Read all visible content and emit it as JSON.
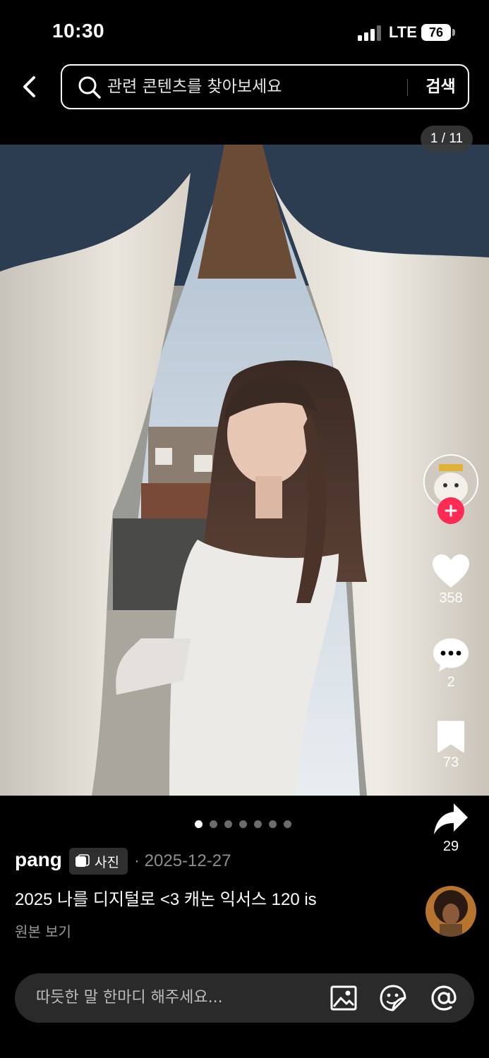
{
  "status_bar": {
    "time": "10:30",
    "network": "LTE",
    "battery": "76"
  },
  "search": {
    "placeholder": "관련 콘텐츠를 찾아보세요",
    "button_label": "검색"
  },
  "photo_counter": "1 / 11",
  "actions": {
    "likes": "358",
    "comments": "2",
    "saves": "73",
    "shares": "29"
  },
  "carousel": {
    "total_dots": 7,
    "active_index": 0
  },
  "post": {
    "username": "pang",
    "type_label": "사진",
    "date": "· 2025-12-27",
    "caption": "2025 나를 디지털로 <3 캐논 익서스 120 is",
    "see_original": "원본 보기"
  },
  "comment_bar": {
    "placeholder": "따듯한 말 한마디 해주세요..."
  },
  "icons": [
    "back-icon",
    "search-icon",
    "plus-icon",
    "heart-icon",
    "comment-icon",
    "bookmark-icon",
    "share-icon",
    "photo-type-icon",
    "image-icon",
    "sticker-icon",
    "mention-icon"
  ],
  "colors": {
    "accent": "#fe2c55",
    "background": "#000000",
    "comment_bar": "#2a2a2a"
  }
}
